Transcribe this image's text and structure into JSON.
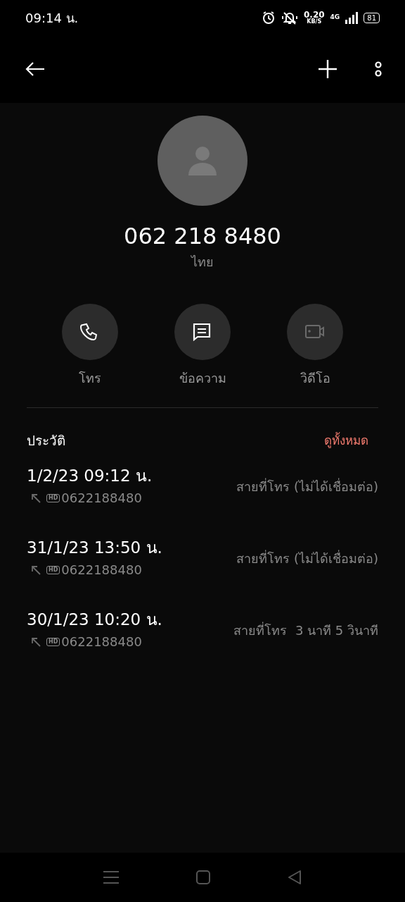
{
  "status_bar": {
    "time": "09:14 น.",
    "net_speed": "0.20",
    "net_unit": "KB/S",
    "network_type": "4G",
    "battery": "81"
  },
  "contact": {
    "number": "062 218 8480",
    "label": "ไทย"
  },
  "actions": [
    {
      "kind": "call",
      "label": "โทร",
      "disabled": false
    },
    {
      "kind": "message",
      "label": "ข้อความ",
      "disabled": false
    },
    {
      "kind": "video",
      "label": "วิดีโอ",
      "disabled": true
    }
  ],
  "history": {
    "title": "ประวัติ",
    "view_all": "ดูทั้งหมด",
    "calls": [
      {
        "datetime": "1/2/23 09:12 น.",
        "badge": "HD",
        "number": "0622188480",
        "status": "สายที่โทร (ไม่ได้เชื่อมต่อ)"
      },
      {
        "datetime": "31/1/23 13:50 น.",
        "badge": "HD",
        "number": "0622188480",
        "status": "สายที่โทร (ไม่ได้เชื่อมต่อ)"
      },
      {
        "datetime": "30/1/23 10:20 น.",
        "badge": "HD",
        "number": "0622188480",
        "status": "สายที่โทร  3 นาที 5 วินาที"
      }
    ]
  }
}
